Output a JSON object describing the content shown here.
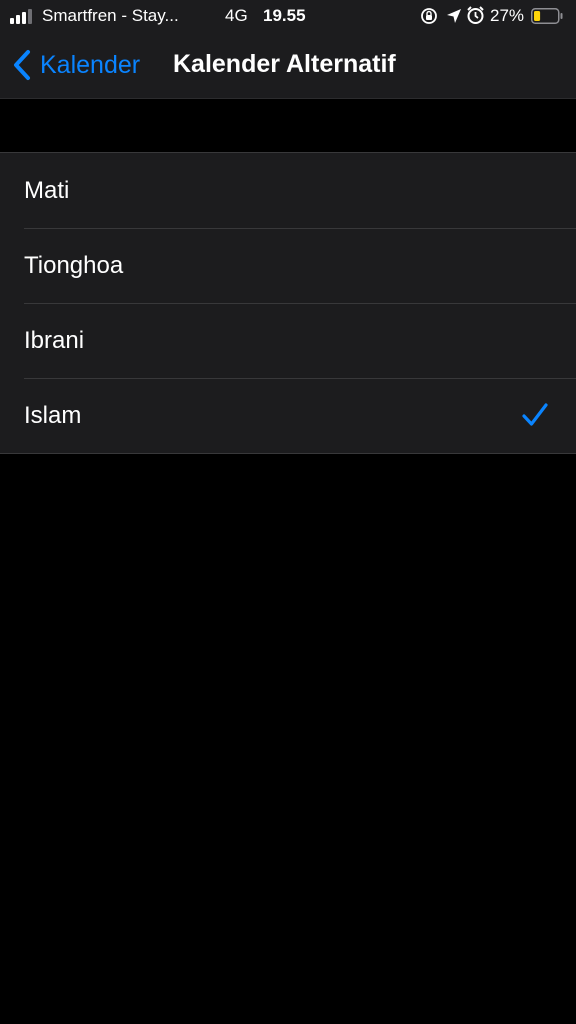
{
  "status_bar": {
    "carrier": "Smartfren - Stay...",
    "network": "4G",
    "time": "19.55",
    "battery_percent": "27%",
    "battery_level": 0.27,
    "battery_color": "#ffd60a",
    "icons": [
      "signal-icon",
      "orientation-lock-icon",
      "location-icon",
      "alarm-icon",
      "battery-icon"
    ]
  },
  "nav": {
    "back_label": "Kalender",
    "title": "Kalender Alternatif",
    "accent_color": "#0a84ff"
  },
  "options": [
    {
      "label": "Mati",
      "selected": false
    },
    {
      "label": "Tionghoa",
      "selected": false
    },
    {
      "label": "Ibrani",
      "selected": false
    },
    {
      "label": "Islam",
      "selected": true
    }
  ]
}
